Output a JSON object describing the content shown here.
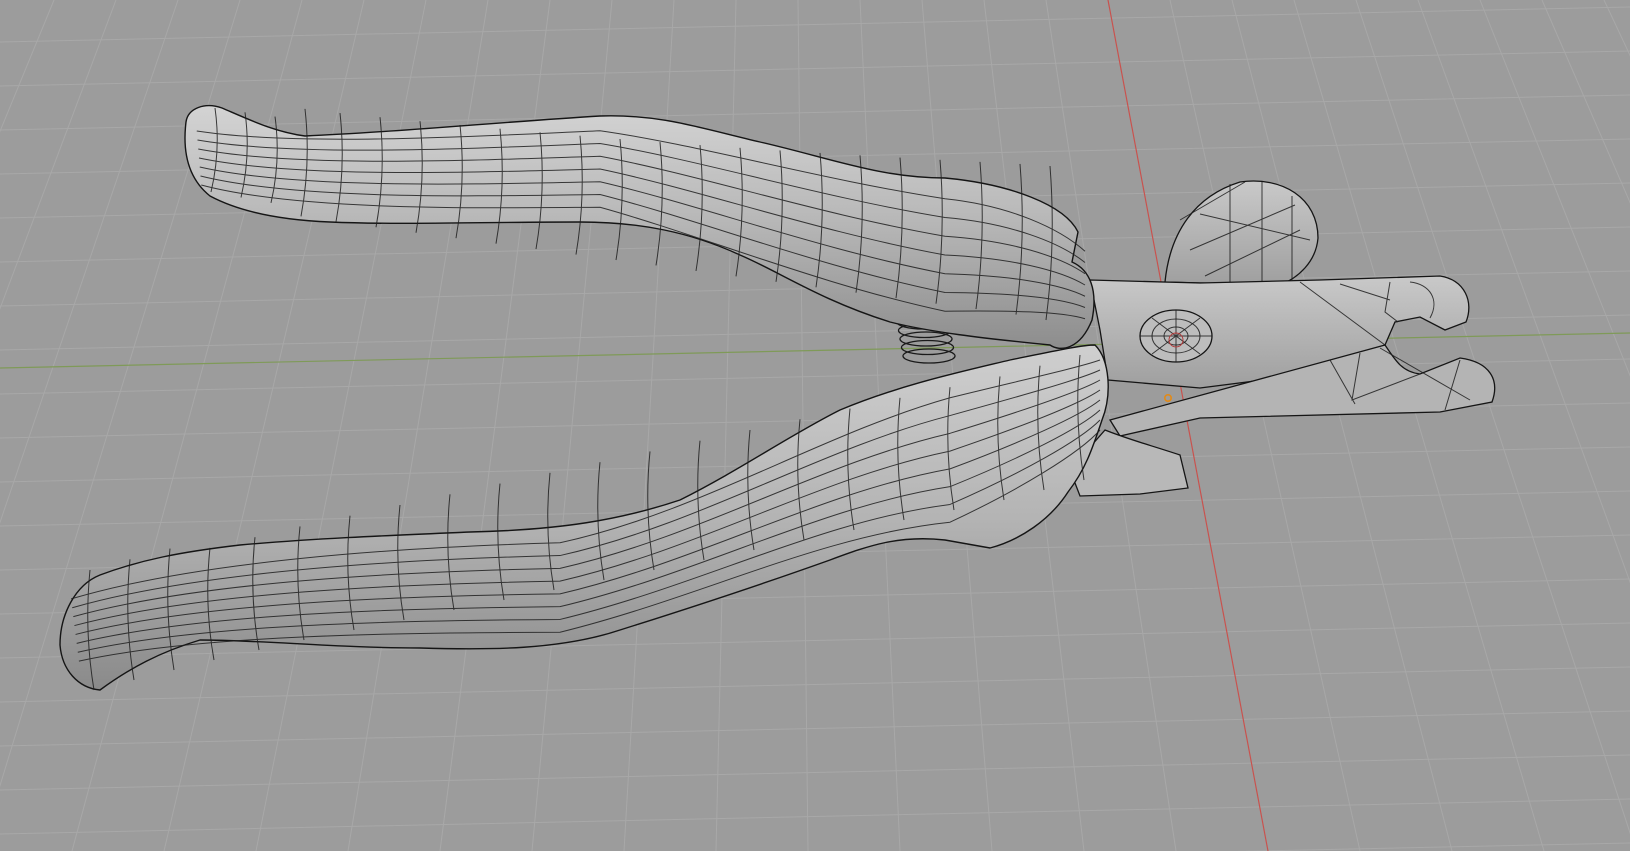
{
  "app": "Blender",
  "view": {
    "type": "3D Viewport",
    "shading": "solid-with-wireframe",
    "background_color": "#9c9c9c",
    "grid_color": "#a8a8a8",
    "x_axis_color": "#c8524e",
    "y_axis_color": "#7f9a58"
  },
  "scene": {
    "object": "pliers",
    "parts": [
      "upper-handle",
      "lower-handle",
      "spring",
      "pivot-bolt",
      "upper-jaw",
      "lower-jaw",
      "jaw-bulb",
      "jaw-flange"
    ],
    "origin_marker": "orange-dot"
  }
}
